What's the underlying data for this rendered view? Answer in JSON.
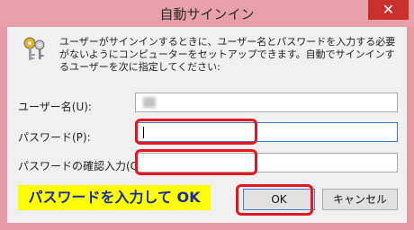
{
  "window": {
    "title": "自動サインイン",
    "close_label": "✕"
  },
  "description": "ユーザーがサインインするときに、ユーザー名とパスワードを入力する必要がないようにコンピューターをセットアップできます。自動でサインインするユーザーを次に指定してください:",
  "fields": {
    "username_label": "ユーザー名(U):",
    "password_label": "パスワード(P):",
    "confirm_label": "パスワードの確認入力(C):"
  },
  "instruction": "パスワードを入力して OK",
  "buttons": {
    "ok": "OK",
    "cancel": "キャンセル"
  },
  "colors": {
    "highlight": "#e8141e",
    "instruction_bg": "#ffff00",
    "instruction_text": "#1a2aa8"
  },
  "icons": {
    "keys": "keys-icon",
    "close": "close-icon"
  }
}
